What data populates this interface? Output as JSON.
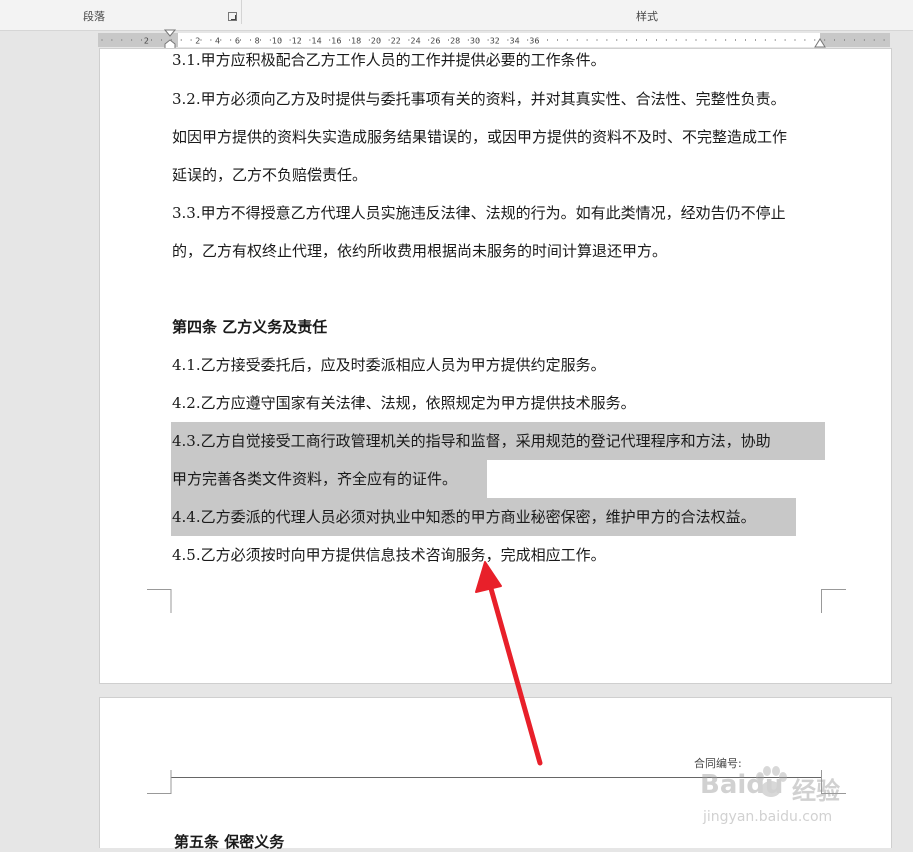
{
  "ribbon": {
    "group_paragraph": "段落",
    "group_styles": "样式"
  },
  "ruler": {
    "ticks": [
      "2",
      "2",
      "4",
      "6",
      "8",
      "10",
      "12",
      "14",
      "16",
      "18",
      "20",
      "22",
      "24",
      "26",
      "28",
      "30",
      "32",
      "34",
      "36"
    ]
  },
  "page1": {
    "lines": [
      "3.1.甲方应积极配合乙方工作人员的工作并提供必要的工作条件。",
      "3.2.甲方必须向乙方及时提供与委托事项有关的资料，并对其真实性、合法性、完整性负责。",
      "如因甲方提供的资料失实造成服务结果错误的，或因甲方提供的资料不及时、不完整造成工作",
      "延误的，乙方不负赔偿责任。",
      "3.3.甲方不得授意乙方代理人员实施违反法律、法规的行为。如有此类情况，经劝告仍不停止",
      "的，乙方有权终止代理，依约所收费用根据尚未服务的时间计算退还甲方。",
      "第四条  乙方义务及责任",
      "4.1.乙方接受委托后，应及时委派相应人员为甲方提供约定服务。",
      "4.2.乙方应遵守国家有关法律、法规，依照规定为甲方提供技术服务。",
      "4.3.乙方自觉接受工商行政管理机关的指导和监督，采用规范的登记代理程序和方法，协助",
      "甲方完善各类文件资料，齐全应有的证件。",
      "4.4.乙方委派的代理人员必须对执业中知悉的甲方商业秘密保密，维护甲方的合法权益。",
      "4.5.乙方必须按时向甲方提供信息技术咨询服务，完成相应工作。"
    ]
  },
  "page2": {
    "contract_no_label": "合同编号:",
    "next_heading": "第五条  保密义务"
  },
  "watermark": {
    "brand": "Baidu",
    "cn": "经验",
    "url": "jingyan.baidu.com"
  },
  "colors": {
    "highlight": "#c8c8c8",
    "arrow": "#e8202a"
  }
}
